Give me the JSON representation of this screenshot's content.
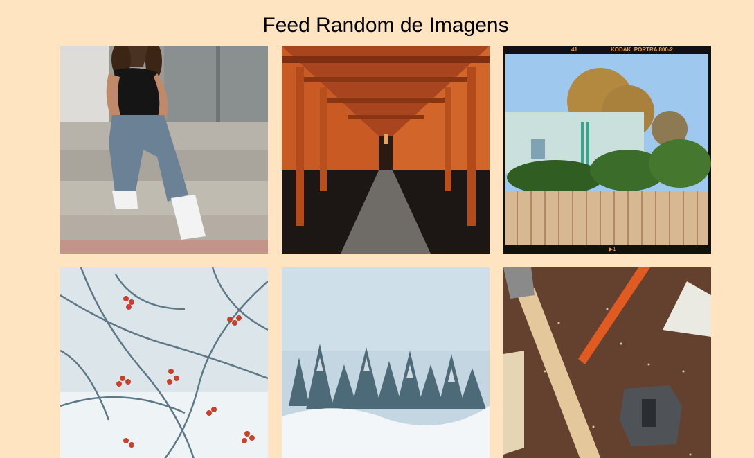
{
  "page": {
    "title": "Feed Random de Imagens"
  },
  "feed": {
    "images": [
      {
        "subject": "woman-sitting-on-steps-photo"
      },
      {
        "subject": "torii-gates-tunnel-photo"
      },
      {
        "subject": "film-frame-house-tree-photo",
        "film_edge_text": "KODAK  PORTRA 800-2",
        "frame_number": "41",
        "frame_marker": "▶1"
      },
      {
        "subject": "frosted-berry-branches-photo"
      },
      {
        "subject": "snowy-forest-photo"
      },
      {
        "subject": "woodworking-tools-photo"
      }
    ]
  },
  "colors": {
    "background": "#ffe4c1"
  }
}
